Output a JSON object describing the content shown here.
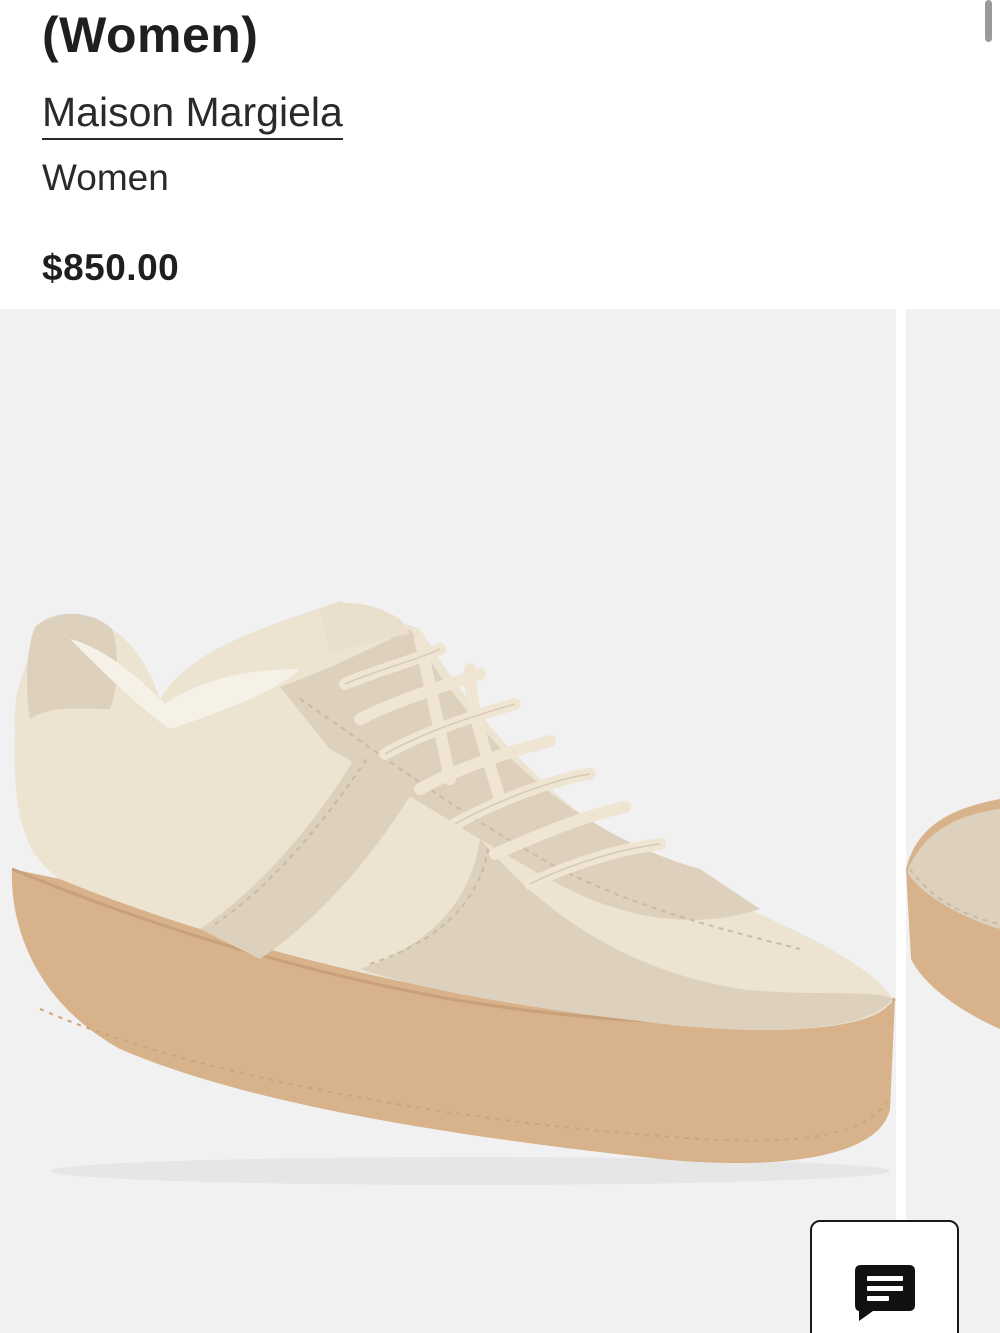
{
  "product": {
    "title": "(Women)",
    "brand": "Maison Margiela",
    "department": "Women",
    "price": "$850.00"
  },
  "gallery": {
    "images": [
      {
        "alt": "Maison Margiela Replica low-top sneaker, off-white leather and suede with gum platform sole"
      },
      {
        "alt": "Maison Margiela Replica sneaker alternate view"
      }
    ]
  },
  "chat": {
    "icon": "chat-bubble-icon",
    "label": "Chat"
  },
  "colors": {
    "text": "#1f1f1f",
    "image_bg": "#f1f1f1",
    "leather": "#ece3d1",
    "suede": "#ddd1bd",
    "gum_sole": "#d7b28a"
  }
}
